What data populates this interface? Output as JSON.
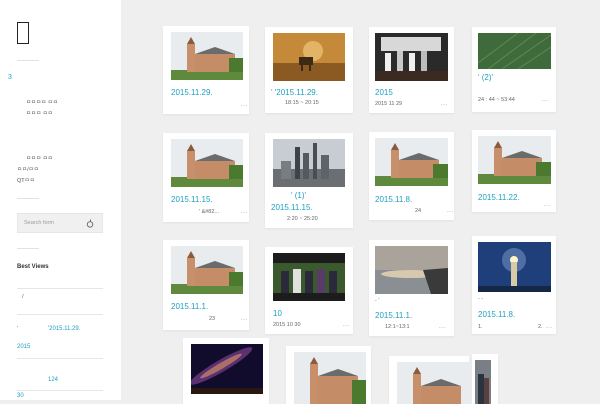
{
  "sidebar": {
    "logo_glyph": "",
    "count": "3",
    "menu": [
      "ㅁㅁㅁㅁ ㅁㅁ",
      "ㅁㅁㅁ ㅁㅁ"
    ],
    "links": [
      "ㅁㅁㅁ ㅁㅁ",
      "ㅁㅁ/ㅁㅁ",
      "QTㅁㅁ"
    ],
    "search_placeholder": "Search form",
    "best_views_title": "Best Views",
    "best_list": [
      {
        "text": "/"
      },
      {
        "text": "'",
        "suffix": "'2015.11.29."
      },
      {
        "text": "2015"
      },
      {
        "text": "124"
      },
      {
        "text": "30"
      }
    ]
  },
  "posts": [
    {
      "title": "2015.11.29.",
      "meta": "",
      "more": "..."
    },
    {
      "title": "'      '2015.11.29.",
      "meta": "18:15 ~ 20:15",
      "more": ""
    },
    {
      "title": "2015",
      "meta": "2015   11   29",
      "more": "..."
    },
    {
      "title": "'            (2)'",
      "meta": "24 : 44 ~ 53:44",
      "more": "..."
    },
    {
      "title": "2015.11.15.",
      "meta": "'              &#82...",
      "more": "..."
    },
    {
      "title": "'             (1)'",
      "meta": "2:20 ~ 25:20",
      "more": "",
      "title2": "2015.11.15."
    },
    {
      "title": "2015.11.8.",
      "meta": "24",
      "more": "..."
    },
    {
      "title": "2015.11.22.",
      "meta": "",
      "more": "..."
    },
    {
      "title": "2015.11.1.",
      "meta": "23",
      "more": "..."
    },
    {
      "title": "10",
      "meta": "2015   10   30",
      "more": "..."
    },
    {
      "title": "2015.11.1.",
      "meta": "12:1~13:1",
      "more": "...",
      "pre": "-          '"
    },
    {
      "title": "2015.11.8.",
      "meta": "1.",
      "meta2": "2.",
      "more": "...",
      "pre": "-                  -"
    }
  ]
}
